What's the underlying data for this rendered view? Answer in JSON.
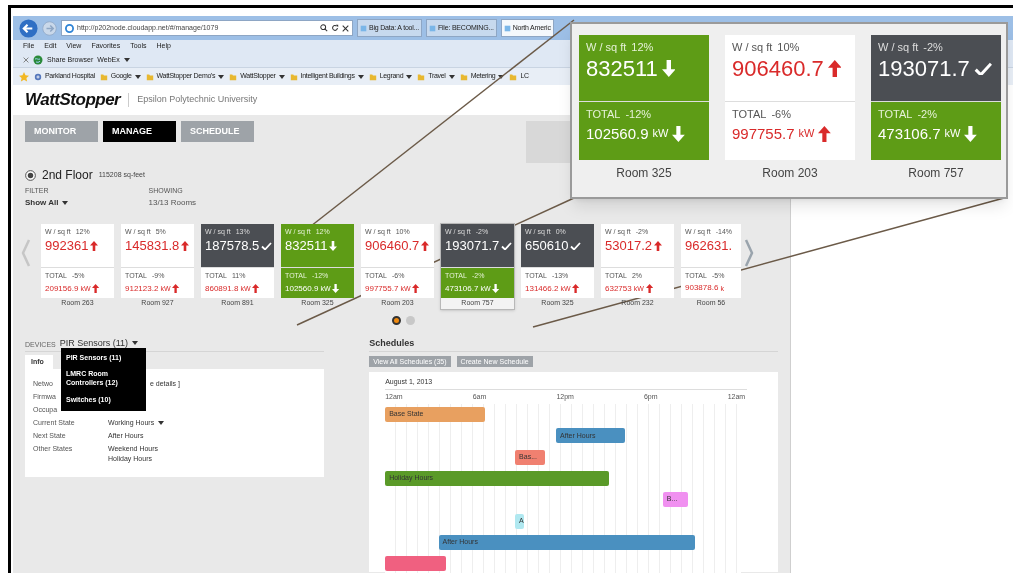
{
  "browser": {
    "url": "http://p202node.cloudapp.net/#/manage/1079",
    "tabs": [
      {
        "label": "Big Data: A tool...",
        "selected": false
      },
      {
        "label": "File: BECOMING...",
        "selected": false
      },
      {
        "label": "North Americ",
        "selected": true
      }
    ],
    "menu": [
      "File",
      "Edit",
      "View",
      "Favorites",
      "Tools",
      "Help"
    ],
    "toolbar": [
      {
        "label": "Share Browser",
        "dropdown": false
      },
      {
        "label": "WebEx",
        "dropdown": true
      }
    ],
    "favorites": [
      {
        "label": "Parkland Hospital",
        "kind": "site",
        "dropdown": false
      },
      {
        "label": "Google",
        "kind": "folder",
        "dropdown": true
      },
      {
        "label": "WattStopper Demo's",
        "kind": "folder",
        "dropdown": true
      },
      {
        "label": "WattStopper",
        "kind": "folder",
        "dropdown": true
      },
      {
        "label": "Intelligent Buildings",
        "kind": "folder",
        "dropdown": true
      },
      {
        "label": "Legrand",
        "kind": "folder",
        "dropdown": true
      },
      {
        "label": "Travel",
        "kind": "folder",
        "dropdown": true
      },
      {
        "label": "Metering",
        "kind": "folder",
        "dropdown": true
      },
      {
        "label": "LC",
        "kind": "folder",
        "dropdown": false
      }
    ]
  },
  "app": {
    "brand": "WattStopper",
    "org": "Epsilon Polytechnic University",
    "nav": [
      {
        "label": "MONITOR",
        "selected": false
      },
      {
        "label": "MANAGE",
        "selected": true
      },
      {
        "label": "SCHEDULE",
        "selected": false
      }
    ],
    "floor": {
      "name": "2nd Floor",
      "area": "115208 sq-feet"
    },
    "filter": {
      "label": "FILTER",
      "value": "Show All"
    },
    "showing": {
      "label": "SHOWING",
      "value": "13/13 Rooms"
    },
    "rooms": [
      {
        "room": "Room 263",
        "selected": false,
        "clipped": false,
        "metric": {
          "label": "W / sq ft",
          "change": "12%",
          "value": "992361",
          "kind": "high"
        },
        "total": {
          "label": "TOTAL",
          "change": "-5%",
          "value": "209156.9",
          "unit": "kW",
          "kind": "high"
        }
      },
      {
        "room": "Room 927",
        "selected": false,
        "clipped": false,
        "metric": {
          "label": "W / sq ft",
          "change": "5%",
          "value": "145831.8",
          "kind": "high"
        },
        "total": {
          "label": "TOTAL",
          "change": "-9%",
          "value": "912123.2",
          "unit": "kW",
          "kind": "high"
        }
      },
      {
        "room": "Room 891",
        "selected": false,
        "clipped": false,
        "metric": {
          "label": "W / sq ft",
          "change": "13%",
          "value": "187578.5",
          "kind": "normal"
        },
        "total": {
          "label": "TOTAL",
          "change": "11%",
          "value": "860891.8",
          "unit": "kW",
          "kind": "high"
        }
      },
      {
        "room": "Room 325",
        "selected": false,
        "clipped": false,
        "metric": {
          "label": "W / sq ft",
          "change": "12%",
          "value": "832511",
          "kind": "low"
        },
        "total": {
          "label": "TOTAL",
          "change": "-12%",
          "value": "102560.9",
          "unit": "kW",
          "kind": "low"
        }
      },
      {
        "room": "Room 203",
        "selected": false,
        "clipped": false,
        "metric": {
          "label": "W / sq ft",
          "change": "10%",
          "value": "906460.7",
          "kind": "high"
        },
        "total": {
          "label": "TOTAL",
          "change": "-6%",
          "value": "997755.7",
          "unit": "kW",
          "kind": "high"
        }
      },
      {
        "room": "Room 757",
        "selected": true,
        "clipped": false,
        "metric": {
          "label": "W / sq ft",
          "change": "-2%",
          "value": "193071.7",
          "kind": "normal"
        },
        "total": {
          "label": "TOTAL",
          "change": "-2%",
          "value": "473106.7",
          "unit": "kW",
          "kind": "low"
        }
      },
      {
        "room": "Room 325",
        "selected": false,
        "clipped": false,
        "metric": {
          "label": "W / sq ft",
          "change": "0%",
          "value": "650610",
          "kind": "normal"
        },
        "total": {
          "label": "TOTAL",
          "change": "-13%",
          "value": "131466.2",
          "unit": "kW",
          "kind": "high"
        }
      },
      {
        "room": "Room 232",
        "selected": false,
        "clipped": false,
        "metric": {
          "label": "W / sq ft",
          "change": "-2%",
          "value": "53017.2",
          "kind": "high"
        },
        "total": {
          "label": "TOTAL",
          "change": "2%",
          "value": "632753",
          "unit": "kW",
          "kind": "high"
        }
      },
      {
        "room": "Room 56",
        "selected": false,
        "clipped": true,
        "metric": {
          "label": "W / sq ft",
          "change": "-14%",
          "value": "962631.",
          "kind": "high"
        },
        "total": {
          "label": "TOTAL",
          "change": "-5%",
          "value": "903878.6",
          "unit": "k",
          "kind": "high"
        }
      }
    ],
    "pager": [
      {
        "selected": true
      },
      {
        "selected": false
      }
    ],
    "devices": {
      "label": "DEVICES",
      "type": "PIR Sensors (11)",
      "tab": "Info",
      "menu": [
        "PIR Sensors (11)",
        "LMRC Room Controllers (12)",
        "Switches (10)"
      ],
      "fields": [
        {
          "label": "Netwo",
          "value": "e details ]"
        },
        {
          "label": "Firmwa"
        },
        {
          "label": "Occupa"
        },
        {
          "label": "Current State",
          "value": "Working Hours",
          "dropdown": true
        },
        {
          "label": "Next State",
          "value": "After Hours",
          "dropdown": false
        },
        {
          "label": "Other States",
          "value": "Weekend Hours",
          "value_2": "Holiday Hours",
          "dropdown": false
        }
      ]
    },
    "schedules": {
      "title": "Schedules",
      "buttons": [
        "View All Schedules (35)",
        "Create New Schedule"
      ],
      "date": "August 1, 2013",
      "axis": [
        "12am",
        "6am",
        "12pm",
        "6pm",
        "12am"
      ],
      "bars": [
        {
          "label": "Base State",
          "color": "#e8a060"
        },
        {
          "label": "After Hours",
          "color": "#4a90c0"
        },
        {
          "label": "Bas...",
          "color": "#f08070"
        },
        {
          "label": "Holiday Hours",
          "color": "#5a9a28"
        },
        {
          "label": "B...",
          "color": "#f090f0"
        },
        {
          "label": "A",
          "color": "#b0e8f0"
        },
        {
          "label": "After Hours",
          "color": "#4a90c0"
        },
        {
          "color": "#f06080"
        }
      ]
    }
  },
  "callout": {
    "rooms": [
      {
        "room": "Room 325",
        "metric": {
          "label": "W / sq ft",
          "change": "12%",
          "value": "832511",
          "kind": "low"
        },
        "total": {
          "label": "TOTAL",
          "change": "-12%",
          "value": "102560.9",
          "unit": "kW",
          "kind": "low"
        }
      },
      {
        "room": "Room 203",
        "metric": {
          "label": "W / sq ft",
          "change": "10%",
          "value": "906460.7",
          "kind": "high"
        },
        "total": {
          "label": "TOTAL",
          "change": "-6%",
          "value": "997755.7",
          "unit": "kW",
          "kind": "high"
        }
      },
      {
        "room": "Room 757",
        "metric": {
          "label": "W / sq ft",
          "change": "-2%",
          "value": "193071.7",
          "kind": "normal"
        },
        "total": {
          "label": "TOTAL",
          "change": "-2%",
          "value": "473106.7",
          "unit": "kW",
          "kind": "low"
        }
      }
    ]
  }
}
